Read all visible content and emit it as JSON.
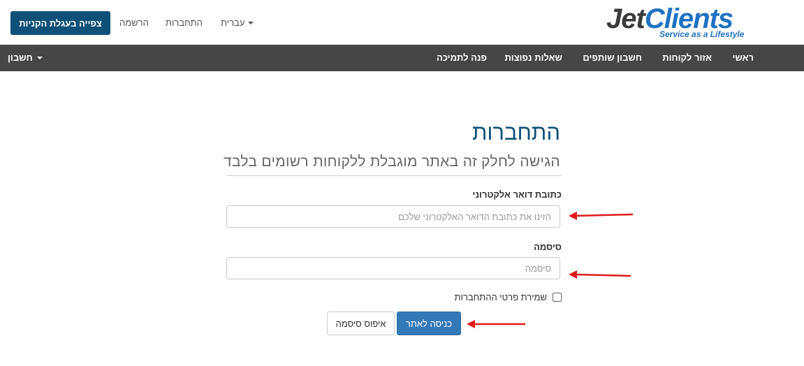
{
  "header": {
    "cart_button": "צפייה בעגלת הקניות",
    "register": "הרשמה",
    "login": "התחברות",
    "language": "עברית",
    "logo_text": "JetClients",
    "logo_tagline": "Service as a Lifestyle"
  },
  "nav": {
    "items": [
      "ראשי",
      "אזור לקוחות",
      "חשבון שותפים",
      "שאלות נפוצות",
      "פנה לתמיכה"
    ],
    "account": "חשבון"
  },
  "form": {
    "title": "התחברות",
    "subtitle": "הגישה לחלק זה באתר מוגבלת ללקוחות רשומים בלבד",
    "email_label": "כתובת דואר אלקטרוני",
    "email_placeholder": "הזינו את כתובת הדואר האלקטרוני שלכם",
    "password_label": "סיסמה",
    "password_placeholder": "סיסמה",
    "remember_label": "שמירת פרטי ההתחברות",
    "login_button": "כניסה לאתר",
    "reset_button": "איפוס סיסמה"
  },
  "colors": {
    "brand": "#0e5077",
    "navbar": "#464646",
    "primary_button": "#3379b7",
    "annotation_arrow": "#e01b1b"
  }
}
